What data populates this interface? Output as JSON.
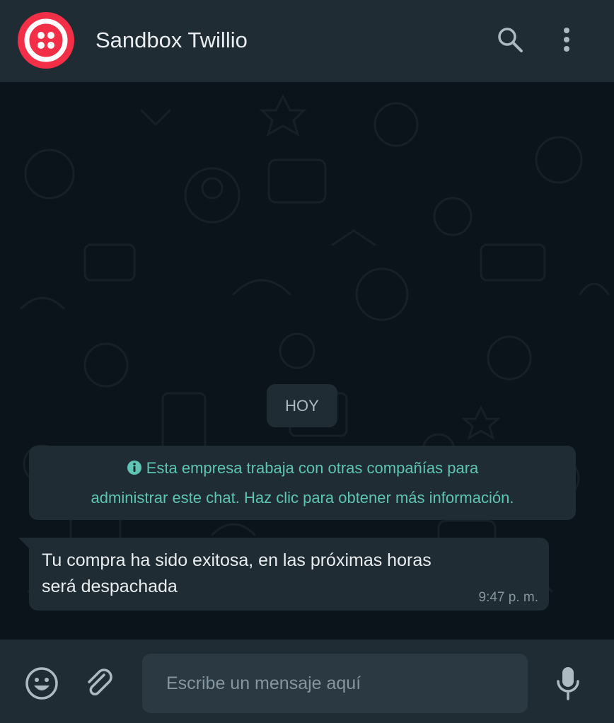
{
  "header": {
    "contact_name": "Sandbox Twillio",
    "avatar_icon": "twilio-logo-icon",
    "search_icon": "search-icon",
    "menu_icon": "more-vertical-icon",
    "avatar_color": "#f22f46"
  },
  "chat": {
    "date_chip": "HOY",
    "system_message": {
      "icon": "info-icon",
      "line1": "Esta empresa trabaja con otras compañías para",
      "line2": "administrar este chat. Haz clic para obtener más información."
    },
    "messages": [
      {
        "direction": "incoming",
        "line1": "Tu compra ha sido exitosa, en las próximas horas",
        "line2": "será despachada",
        "time": "9:47 p. m."
      }
    ]
  },
  "footer": {
    "emoji_icon": "emoji-icon",
    "attach_icon": "paperclip-icon",
    "mic_icon": "microphone-icon",
    "input_placeholder": "Escribe un mensaje aquí",
    "input_value": ""
  },
  "colors": {
    "header_bg": "#202c33",
    "chat_bg": "#0b141a",
    "bubble_bg": "#1f2c33",
    "system_text": "#5ec4b4",
    "text_primary": "#e9edef",
    "text_secondary": "#8696a0"
  }
}
